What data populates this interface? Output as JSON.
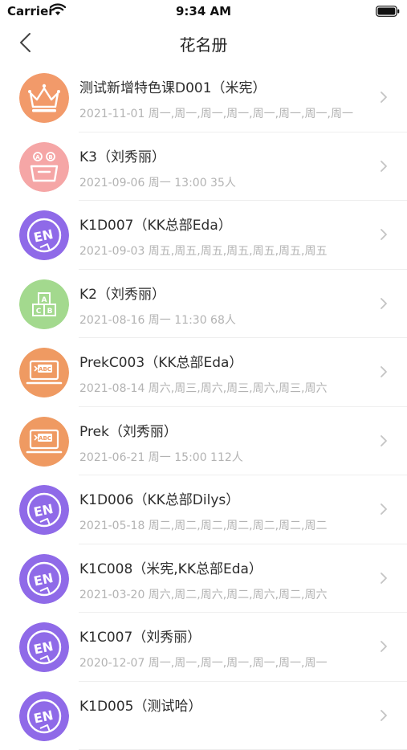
{
  "status": {
    "carrier": "Carrier",
    "time": "9:34 AM"
  },
  "nav": {
    "title": "花名册"
  },
  "items": [
    {
      "title": "测试新增特色课D001（米宪）",
      "sub": "2021-11-01  周一,周一,周一,周一,周一,周一,周一,周一",
      "icon": "crown-icon",
      "color": "#f29a6a"
    },
    {
      "title": "K3（刘秀丽）",
      "sub": "2021-09-06  周一  13:00  35人",
      "icon": "abc-box-icon",
      "color": "#f5a6a6"
    },
    {
      "title": "K1D007（KK总部Eda）",
      "sub": "2021-09-03  周五,周五,周五,周五,周五,周五,周五",
      "icon": "en-logo-icon",
      "color": "#8f6ae8"
    },
    {
      "title": "K2（刘秀丽）",
      "sub": "2021-08-16  周一  11:30  68人",
      "icon": "abc-blocks-icon",
      "color": "#a3d98e"
    },
    {
      "title": "PrekC003（KK总部Eda）",
      "sub": "2021-08-14  周六,周三,周六,周三,周六,周三,周六",
      "icon": "laptop-abc-icon",
      "color": "#ef9a62"
    },
    {
      "title": "Prek（刘秀丽）",
      "sub": "2021-06-21  周一  15:00  112人",
      "icon": "laptop-abc-icon",
      "color": "#ef9a62"
    },
    {
      "title": "K1D006（KK总部Dilys）",
      "sub": "2021-05-18  周二,周二,周二,周二,周二,周二,周二",
      "icon": "en-logo-icon",
      "color": "#8f6ae8"
    },
    {
      "title": "K1C008（米宪,KK总部Eda）",
      "sub": "2021-03-20  周六,周二,周六,周二,周六,周二,周六",
      "icon": "en-logo-icon",
      "color": "#8f6ae8"
    },
    {
      "title": "K1C007（刘秀丽）",
      "sub": "2020-12-07  周一,周一,周一,周一,周一,周一,周一",
      "icon": "en-logo-icon",
      "color": "#8f6ae8"
    },
    {
      "title": "K1D005（测试哈）",
      "sub": "",
      "icon": "en-logo-icon",
      "color": "#8f6ae8"
    }
  ]
}
